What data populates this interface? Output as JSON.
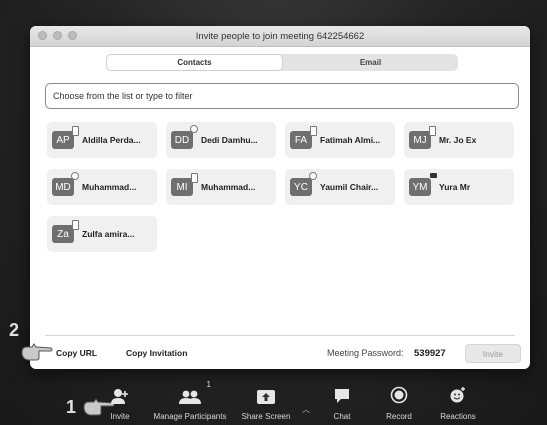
{
  "window": {
    "title": "Invite people to join meeting 642254662"
  },
  "tabs": [
    {
      "label": "Contacts",
      "active": true
    },
    {
      "label": "Email",
      "active": false
    }
  ],
  "filter": {
    "placeholder": "Choose from the list or type to filter"
  },
  "contacts": [
    {
      "initials": "AP",
      "name": "Aldilla Perda...",
      "status_icon": "phone-icon"
    },
    {
      "initials": "DD",
      "name": "Dedi Damhu...",
      "status_icon": "ring-icon"
    },
    {
      "initials": "FA",
      "name": "Fatimah Almi...",
      "status_icon": "phone-icon"
    },
    {
      "initials": "MJ",
      "name": "Mr. Jo Ex",
      "status_icon": "phone-icon"
    },
    {
      "initials": "MD",
      "name": "Muhammad...",
      "status_icon": "ring-icon"
    },
    {
      "initials": "MI",
      "name": "Muhammad...",
      "status_icon": "phone-icon"
    },
    {
      "initials": "YC",
      "name": "Yaumil Chair...",
      "status_icon": "ring-icon"
    },
    {
      "initials": "YM",
      "name": "Yura Mr",
      "status_icon": "video-icon"
    },
    {
      "initials": "Za",
      "name": "Zulfa amira...",
      "status_icon": "phone-icon"
    }
  ],
  "footer": {
    "copy_url": "Copy URL",
    "copy_invitation": "Copy Invitation",
    "password_label": "Meeting Password:",
    "password_value": "539927",
    "invite_button": "Invite"
  },
  "annotations": {
    "step1": "1",
    "step2": "2"
  },
  "toolbar": {
    "items": [
      {
        "label": "Invite",
        "icon": "add-user-icon"
      },
      {
        "label": "Manage Participants",
        "icon": "participants-icon",
        "count": "1"
      },
      {
        "label": "Share Screen",
        "icon": "share-screen-icon"
      },
      {
        "label": "Chat",
        "icon": "chat-icon"
      },
      {
        "label": "Record",
        "icon": "record-icon"
      },
      {
        "label": "Reactions",
        "icon": "reactions-icon"
      }
    ]
  },
  "colors": {
    "background": "#1b1b1b",
    "dialog": "#ffffff",
    "avatar": "#6f6f6f",
    "card": "#f0f0f0"
  }
}
